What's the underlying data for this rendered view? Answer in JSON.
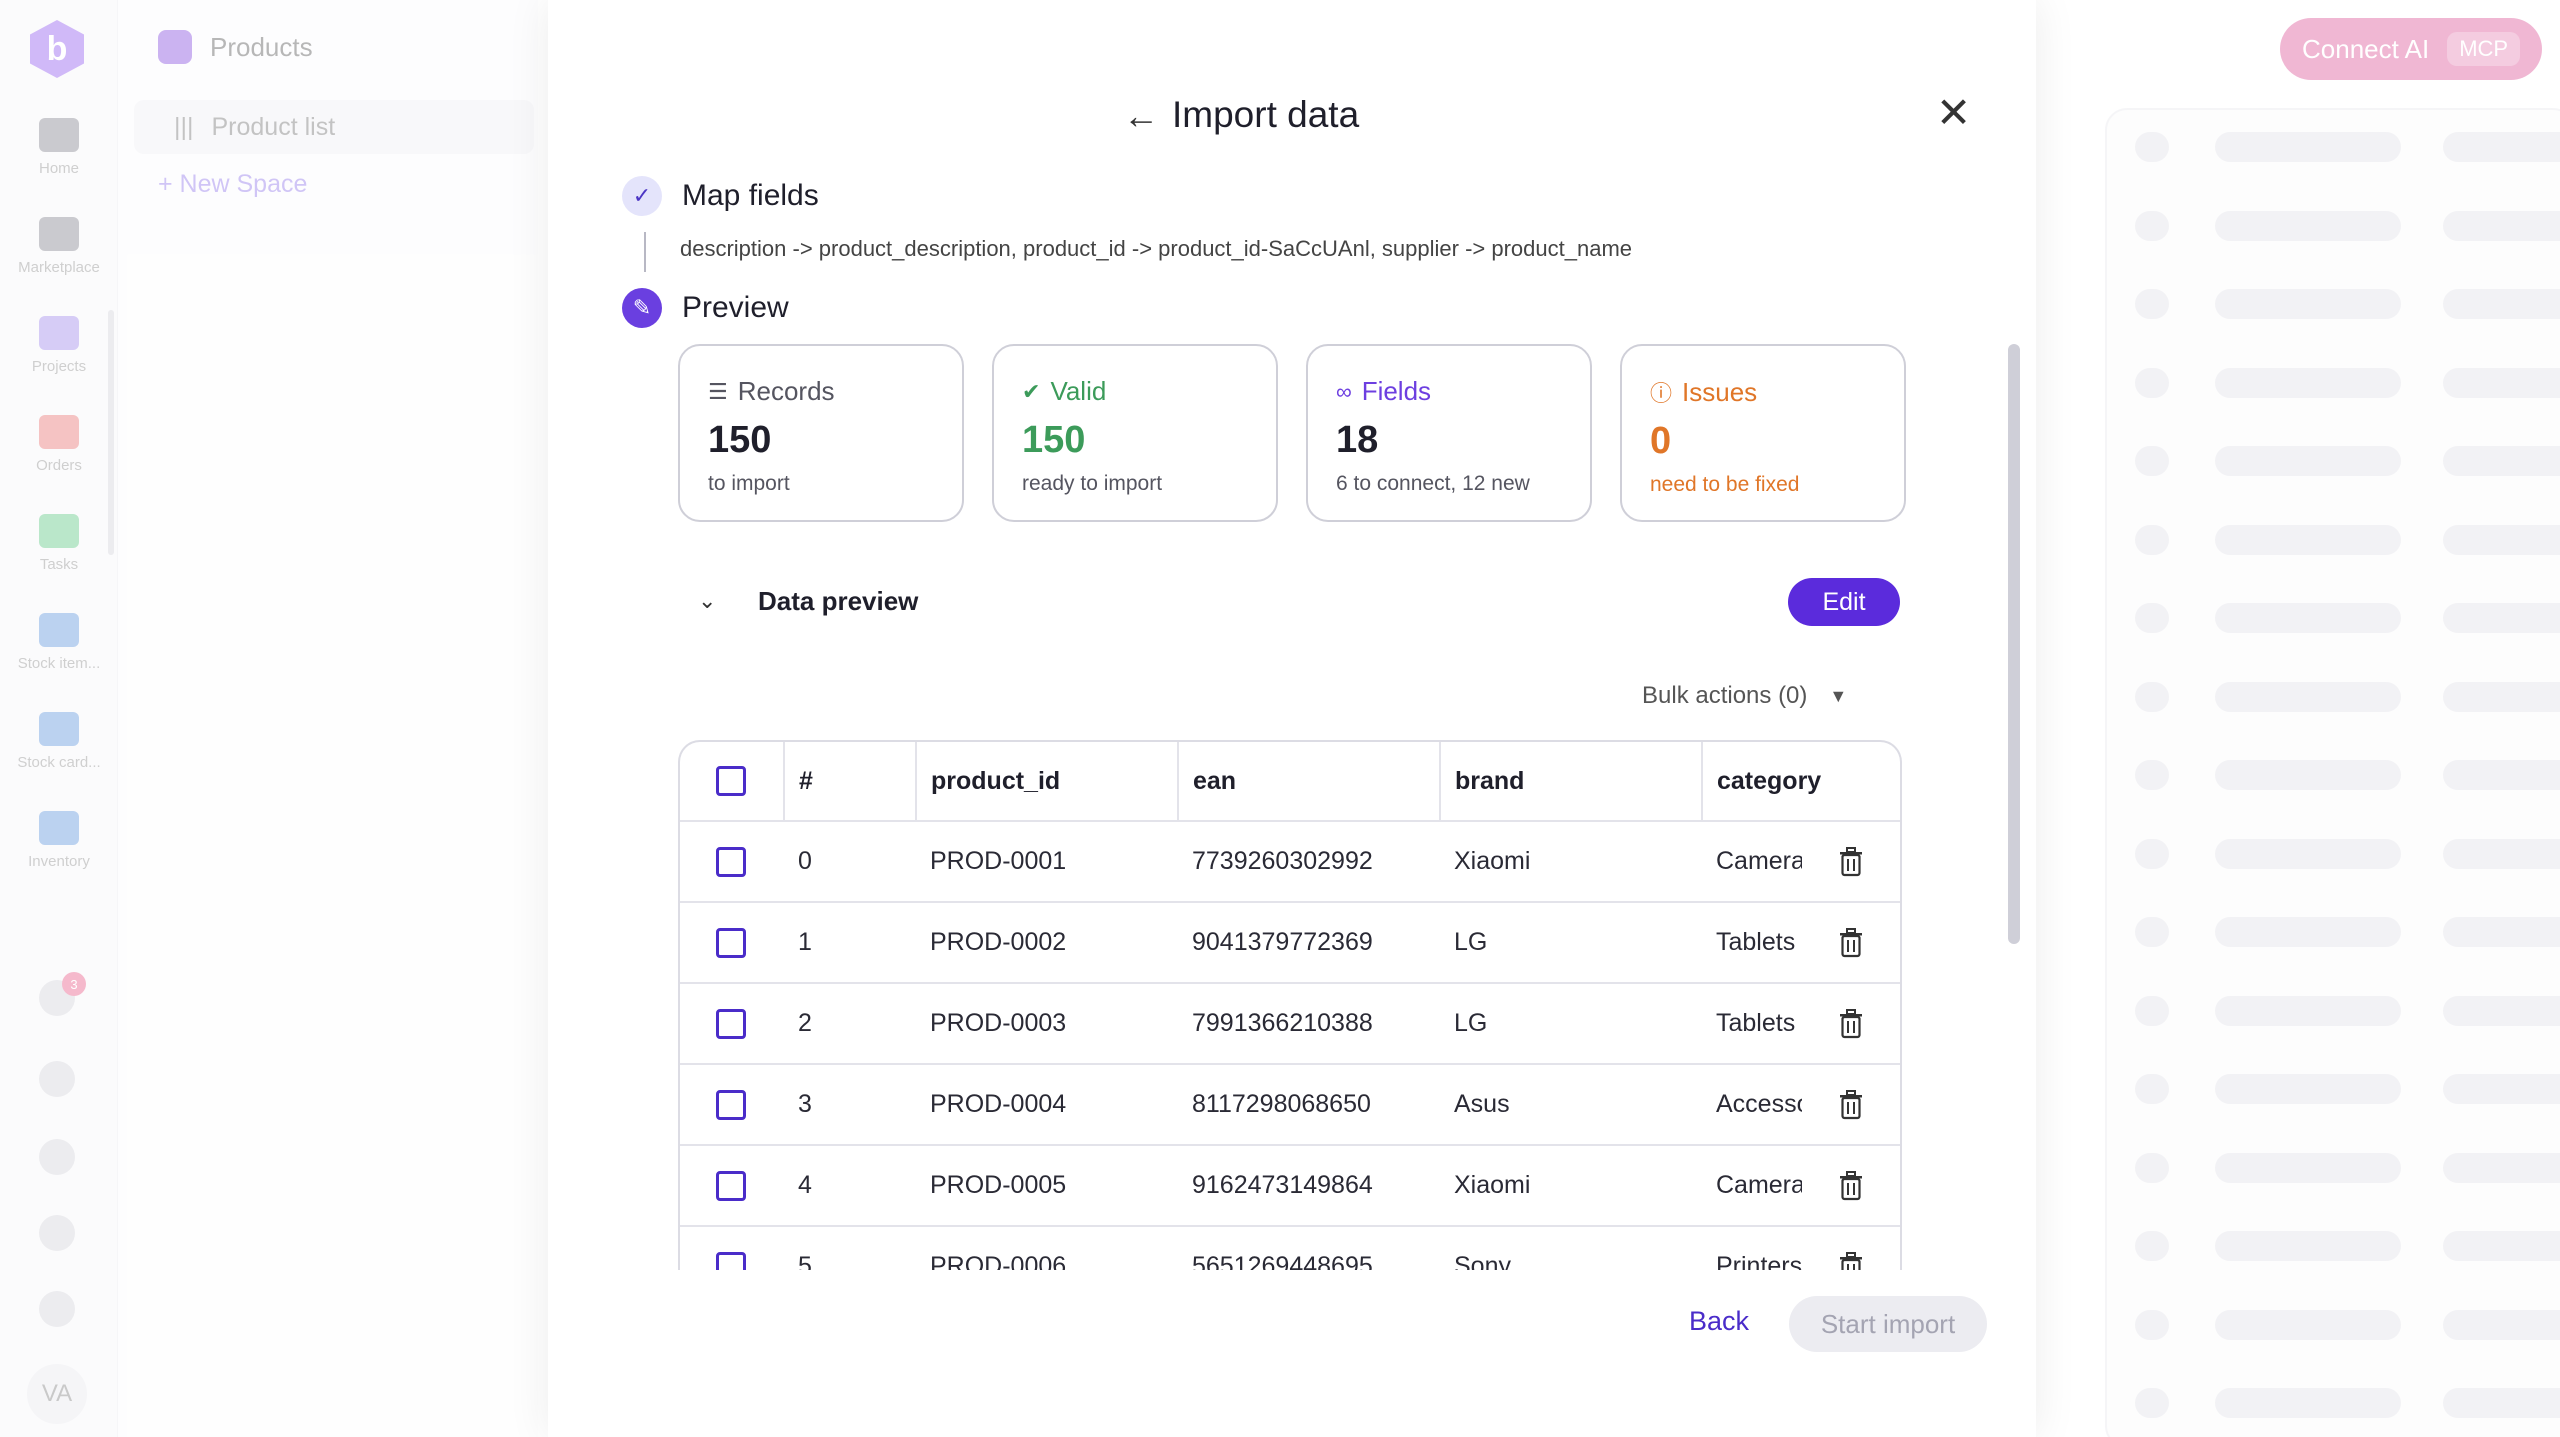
{
  "app": {
    "logo_letter": "b",
    "rail_items": [
      {
        "label": "Home",
        "icon": "home-icon",
        "color": "#6b6b78"
      },
      {
        "label": "Marketplace",
        "icon": "store-icon",
        "color": "#6b6b78"
      },
      {
        "label": "Projects",
        "icon": "folder-icon",
        "color": "#8b6ee8"
      },
      {
        "label": "Orders",
        "icon": "orders-icon",
        "color": "#e35555"
      },
      {
        "label": "Tasks",
        "icon": "check-icon",
        "color": "#3dbb6a"
      },
      {
        "label": "Stock item...",
        "icon": "boxes-icon",
        "color": "#3f7fd6"
      },
      {
        "label": "Stock card...",
        "icon": "clipboard-icon",
        "color": "#3f7fd6"
      },
      {
        "label": "Inventory",
        "icon": "inventory-icon",
        "color": "#3f7fd6"
      }
    ],
    "notification_count": "3",
    "avatar_initials": "VA",
    "space": {
      "title": "Products",
      "item": "Product list",
      "new_space": "+ New Space"
    },
    "connect_ai": {
      "label": "Connect AI",
      "badge": "MCP"
    }
  },
  "modal": {
    "title": "Import data",
    "steps": [
      {
        "label": "Map fields",
        "status": "done"
      },
      {
        "label": "Preview",
        "status": "active"
      }
    ],
    "mapping_text": "description -> product_description, product_id -> product_id-SaCcUAnl, supplier -> product_name",
    "stats": [
      {
        "label": "Records",
        "value": "150",
        "sub": "to import",
        "icon": "document-icon",
        "color": "#555560",
        "sub_color": "#555560",
        "value_color": "#1f1f2b"
      },
      {
        "label": "Valid",
        "value": "150",
        "sub": "ready to import",
        "icon": "check-circle-icon",
        "color": "#3c9b5a",
        "sub_color": "#555560",
        "value_color": "#3c9b5a"
      },
      {
        "label": "Fields",
        "value": "18",
        "sub": "6 to connect, 12 new",
        "icon": "link-icon",
        "color": "#6d3fe0",
        "sub_color": "#555560",
        "value_color": "#1f1f2b"
      },
      {
        "label": "Issues",
        "value": "0",
        "sub": "need to be fixed",
        "icon": "alert-circle-icon",
        "color": "#e07628",
        "sub_color": "#e07628",
        "value_color": "#e07628"
      }
    ],
    "data_preview": {
      "title": "Data preview",
      "edit_label": "Edit",
      "bulk_actions": "Bulk actions (0)",
      "columns": [
        "#",
        "product_id",
        "ean",
        "brand",
        "category"
      ],
      "rows": [
        {
          "num": "0",
          "product_id": "PROD-0001",
          "ean": "7739260302992",
          "brand": "Xiaomi",
          "category": "Cameras"
        },
        {
          "num": "1",
          "product_id": "PROD-0002",
          "ean": "9041379772369",
          "brand": "LG",
          "category": "Tablets"
        },
        {
          "num": "2",
          "product_id": "PROD-0003",
          "ean": "7991366210388",
          "brand": "LG",
          "category": "Tablets"
        },
        {
          "num": "3",
          "product_id": "PROD-0004",
          "ean": "8117298068650",
          "brand": "Asus",
          "category": "Accessories"
        },
        {
          "num": "4",
          "product_id": "PROD-0005",
          "ean": "9162473149864",
          "brand": "Xiaomi",
          "category": "Cameras"
        },
        {
          "num": "5",
          "product_id": "PROD-0006",
          "ean": "5651269448695",
          "brand": "Sony",
          "category": "Printers"
        }
      ]
    },
    "footer": {
      "back_label": "Back",
      "start_label": "Start import"
    }
  },
  "colors": {
    "accent": "#5b2bdc",
    "brand_pink": "#d63384"
  }
}
